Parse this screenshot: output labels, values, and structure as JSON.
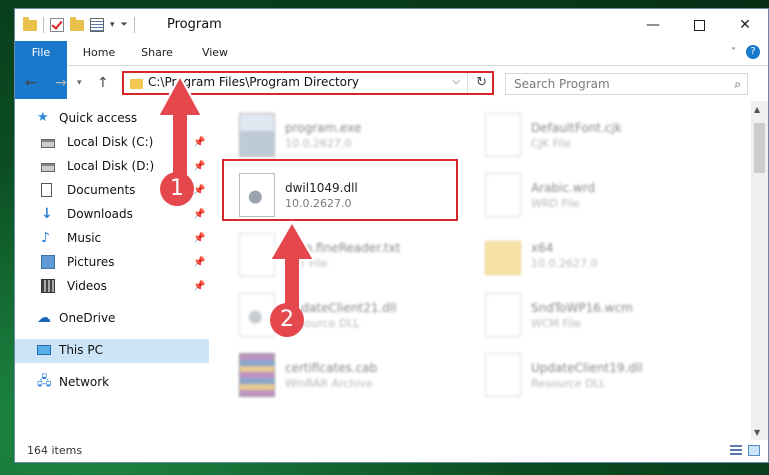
{
  "window": {
    "title": "Program"
  },
  "ribbon": {
    "tabs": [
      "File",
      "Home",
      "Share",
      "View"
    ],
    "help": "?"
  },
  "address": {
    "path": "C:\\Program Files\\Program Directory"
  },
  "search": {
    "placeholder": "Search Program"
  },
  "sidebar": {
    "items": [
      {
        "label": "Quick access",
        "icon": "star-icon"
      },
      {
        "label": "Local Disk (C:)",
        "icon": "disk-icon"
      },
      {
        "label": "Local Disk (D:)",
        "icon": "disk-icon"
      },
      {
        "label": "Documents",
        "icon": "document-icon"
      },
      {
        "label": "Downloads",
        "icon": "download-icon"
      },
      {
        "label": "Music",
        "icon": "music-icon"
      },
      {
        "label": "Pictures",
        "icon": "pictures-icon"
      },
      {
        "label": "Videos",
        "icon": "videos-icon"
      },
      {
        "label": "OneDrive",
        "icon": "cloud-icon"
      },
      {
        "label": "This PC",
        "icon": "computer-icon"
      },
      {
        "label": "Network",
        "icon": "network-icon"
      }
    ]
  },
  "files": [
    {
      "name": "program.exe",
      "desc": "10.0.2627.0",
      "icon": "exe-icon"
    },
    {
      "name": "DefaultFont.cjk",
      "desc": "CJK File",
      "icon": "file-icon"
    },
    {
      "name": "dwil1049.dll",
      "desc": "10.0.2627.0",
      "icon": "dll-gear-icon"
    },
    {
      "name": "Arabic.wrd",
      "desc": "WRD File",
      "icon": "file-icon"
    },
    {
      "name": "Help.fineReader.txt",
      "desc": "TXT File",
      "icon": "file-icon"
    },
    {
      "name": "x64",
      "desc": "10.0.2627.0",
      "icon": "folder-icon"
    },
    {
      "name": "UpdateClient21.dll",
      "desc": "Resource DLL",
      "icon": "dll-gear-icon"
    },
    {
      "name": "SndToWP16.wcm",
      "desc": "WCM File",
      "icon": "file-icon"
    },
    {
      "name": "certificates.cab",
      "desc": "WinRAR Archive",
      "icon": "archive-icon"
    },
    {
      "name": "UpdateClient19.dll",
      "desc": "Resource DLL",
      "icon": "file-icon"
    }
  ],
  "status": {
    "count": "164 items"
  },
  "annotations": {
    "step1": "1",
    "step2": "2",
    "color": "#e4484c"
  }
}
